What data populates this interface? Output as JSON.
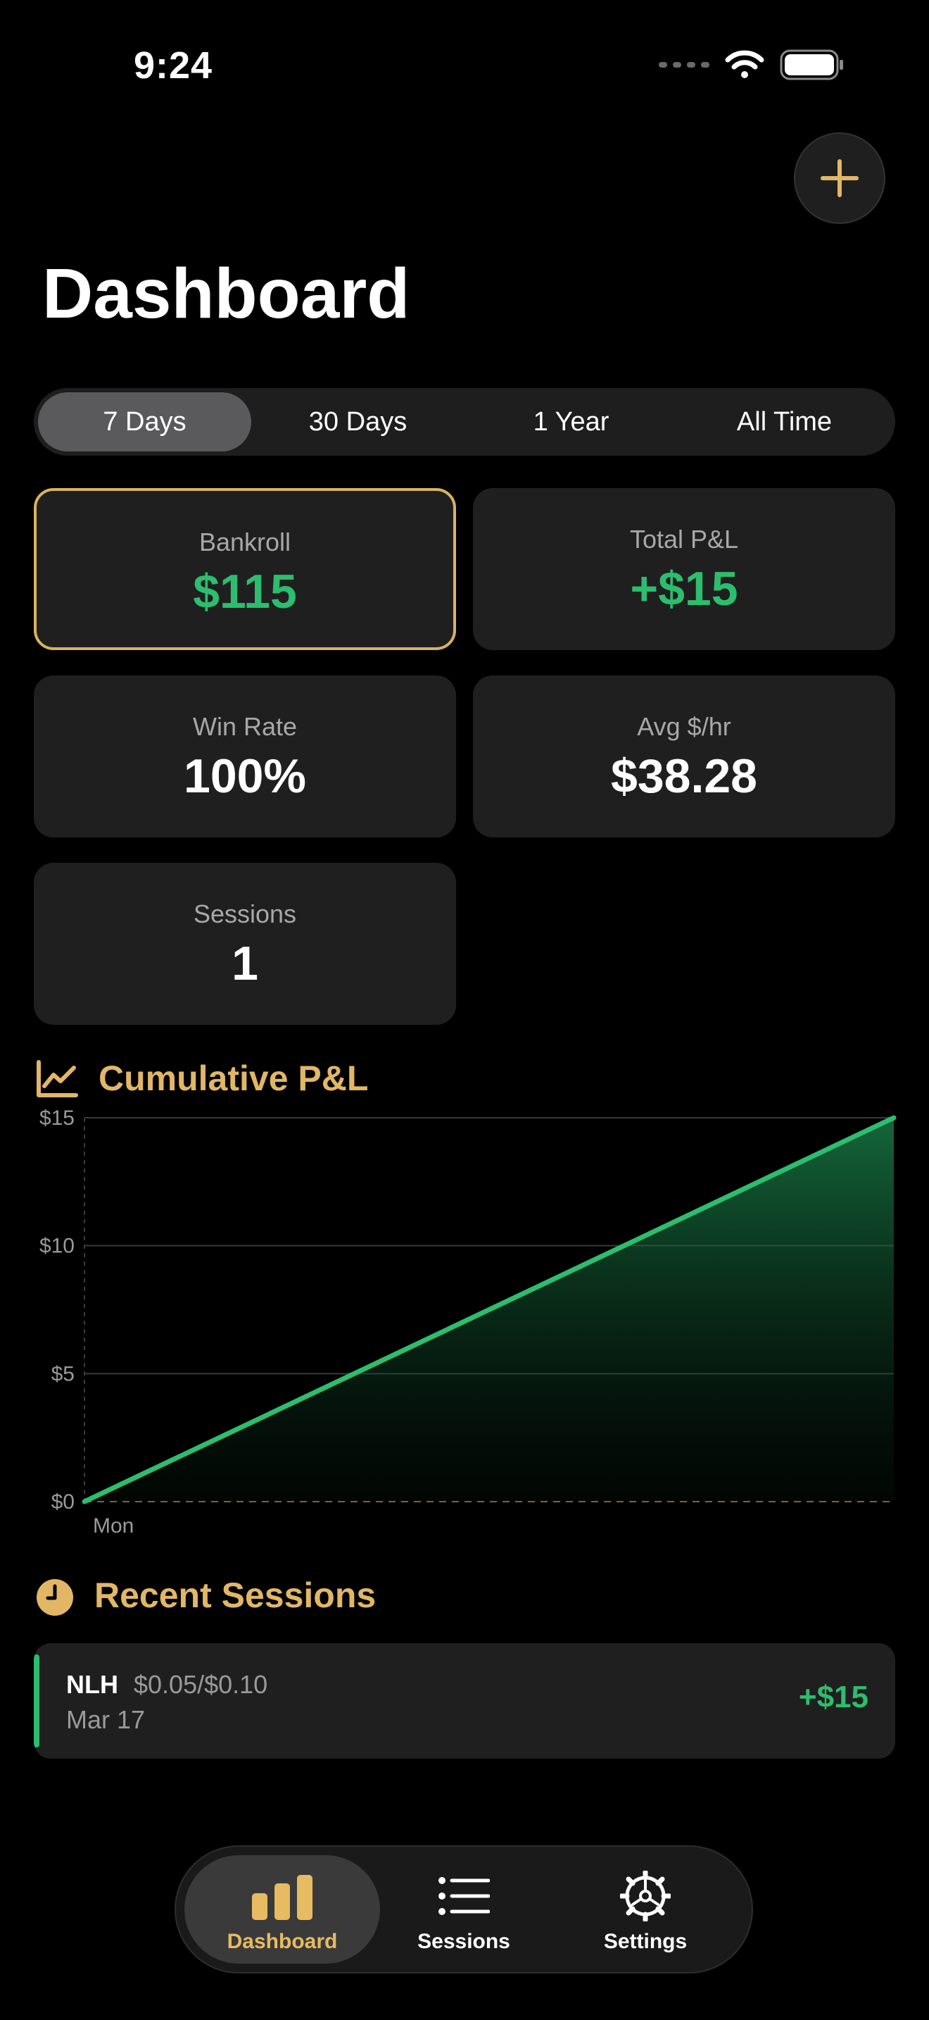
{
  "status_bar": {
    "time": "9:24"
  },
  "header": {
    "title": "Dashboard",
    "add_icon": "plus-icon"
  },
  "ranges": [
    {
      "label": "7 Days",
      "active": true
    },
    {
      "label": "30 Days",
      "active": false
    },
    {
      "label": "1 Year",
      "active": false
    },
    {
      "label": "All Time",
      "active": false
    }
  ],
  "stats": {
    "bankroll": {
      "label": "Bankroll",
      "value": "$115"
    },
    "total_pl": {
      "label": "Total P&L",
      "value": "+$15"
    },
    "win_rate": {
      "label": "Win Rate",
      "value": "100%"
    },
    "avg_hr": {
      "label": "Avg $/hr",
      "value": "$38.28"
    },
    "sessions": {
      "label": "Sessions",
      "value": "1"
    }
  },
  "cumulative_section": {
    "title": "Cumulative P&L",
    "icon": "line-chart-icon"
  },
  "chart_data": {
    "type": "area",
    "x": [
      "",
      "Mon"
    ],
    "series": [
      {
        "values": [
          0,
          15
        ]
      }
    ],
    "yticks": [
      "$0",
      "$5",
      "$10",
      "$15"
    ],
    "ylim": [
      0,
      15
    ],
    "x_tick_labels": [
      "Mon"
    ],
    "grid": true,
    "line_color": "#2dbd6e"
  },
  "recent_section": {
    "title": "Recent Sessions",
    "icon": "clock-icon"
  },
  "sessions": [
    {
      "game": "NLH",
      "stakes": "$0.05/$0.10",
      "date": "Mar 17",
      "amount": "+$15"
    }
  ],
  "tabs": [
    {
      "label": "Dashboard",
      "icon": "bar-chart-icon",
      "active": true
    },
    {
      "label": "Sessions",
      "icon": "list-icon",
      "active": false
    },
    {
      "label": "Settings",
      "icon": "gear-icon",
      "active": false
    }
  ],
  "colors": {
    "accent": "#e1b766",
    "positive": "#2dbd6e",
    "card": "#1f1f1f"
  }
}
